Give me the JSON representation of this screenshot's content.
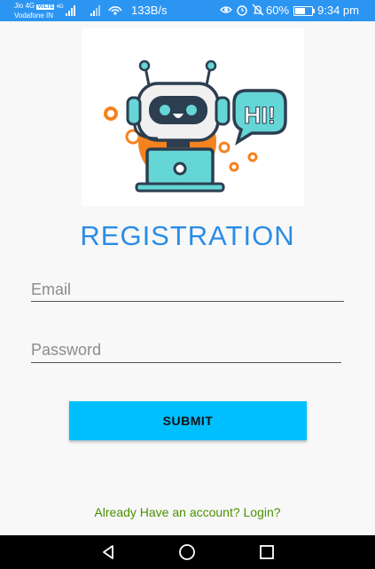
{
  "status_bar": {
    "carrier1": "Jio 4G",
    "volte_badge": "VoLTE",
    "carrier1_tag": "4G",
    "carrier2": "Vodafone IN",
    "net_speed": "133B/s",
    "battery_percent": "60%",
    "battery_level": 0.6,
    "time": "9:34 pm",
    "icons": [
      "signal-icon",
      "signal-icon",
      "wifi-hotspot-icon",
      "eye-icon",
      "alarm-icon",
      "mute-notification-icon",
      "battery-icon"
    ]
  },
  "logo": {
    "bubble_text": "HI!",
    "icon": "robot-chatbot-logo"
  },
  "form": {
    "title": "REGISTRATION",
    "email_placeholder": "Email",
    "email_value": "",
    "password_placeholder": "Password",
    "password_value": "",
    "submit_label": "SUBMIT",
    "login_link": "Already Have an account? Login?"
  },
  "colors": {
    "status_bar": "#2c95f2",
    "title": "#2b8ce6",
    "submit_bg": "#00bfff",
    "link": "#4a8f00",
    "nav_bar": "#000000"
  },
  "nav_bar": {
    "icons": [
      "back-icon",
      "home-icon",
      "recents-icon"
    ]
  }
}
